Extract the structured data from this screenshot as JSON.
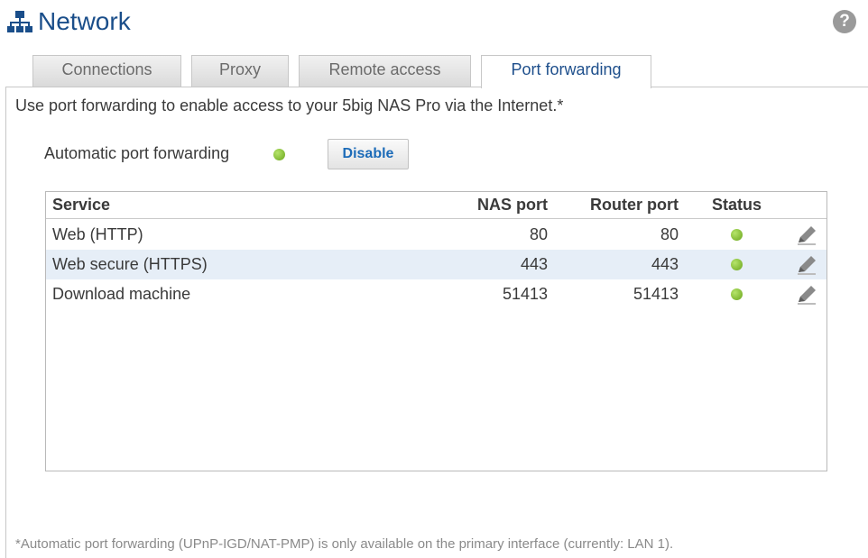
{
  "header": {
    "title": "Network",
    "icon": "network-icon",
    "help_icon": "help-icon",
    "title_color": "#1a4e8a"
  },
  "tabs": [
    {
      "label": "Connections",
      "active": false
    },
    {
      "label": "Proxy",
      "active": false
    },
    {
      "label": "Remote access",
      "active": false
    },
    {
      "label": "Port forwarding",
      "active": true
    }
  ],
  "intro": "Use port forwarding to enable access to your 5big NAS Pro via the Internet.*",
  "auto_forwarding": {
    "label": "Automatic port forwarding",
    "status": "enabled",
    "status_color": "#7fbf2a",
    "button_label": "Disable"
  },
  "table": {
    "columns": [
      "Service",
      "NAS port",
      "Router port",
      "Status"
    ],
    "rows": [
      {
        "service": "Web (HTTP)",
        "nas_port": "80",
        "router_port": "80",
        "status": "active"
      },
      {
        "service": "Web secure (HTTPS)",
        "nas_port": "443",
        "router_port": "443",
        "status": "active"
      },
      {
        "service": "Download machine",
        "nas_port": "51413",
        "router_port": "51413",
        "status": "active"
      }
    ]
  },
  "footnote": "*Automatic port forwarding (UPnP-IGD/NAT-PMP) is only available on the primary interface (currently: LAN 1)."
}
